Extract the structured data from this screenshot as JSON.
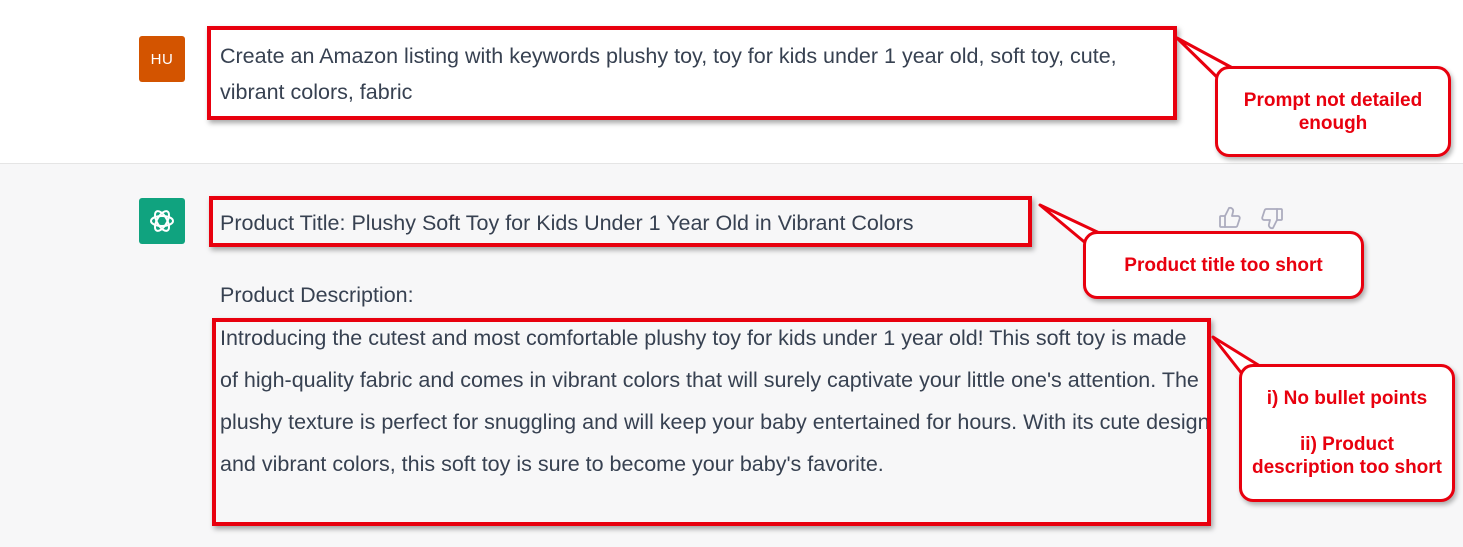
{
  "conversation": {
    "user": {
      "avatar_initials": "HU",
      "avatar_color": "#d35400",
      "message": "Create an Amazon listing with keywords plushy toy, toy for kids under 1 year old, soft toy, cute, vibrant colors, fabric"
    },
    "assistant": {
      "avatar_icon": "openai-logo-icon",
      "avatar_color": "#10a37f",
      "product_title": "Product Title: Plushy Soft Toy for Kids Under 1 Year Old in Vibrant Colors",
      "description_label": "Product Description:",
      "description_body": "Introducing the cutest and most comfortable plushy toy for kids under 1 year old! This soft toy is made of high-quality fabric and comes in vibrant colors that will surely captivate your little one's attention. The plushy texture is perfect for snuggling and will keep your baby entertained for hours. With its cute design and vibrant colors, this soft toy is sure to become your baby's favorite.",
      "feedback_icons": [
        "thumbs-up-icon",
        "thumbs-down-icon"
      ]
    }
  },
  "annotations": {
    "color": "#e8000e",
    "prompt_callout": "Prompt not detailed enough",
    "title_callout": "Product title too short",
    "description_callout": {
      "line1": "i) No bullet points",
      "line2": "ii) Product description too short"
    }
  }
}
